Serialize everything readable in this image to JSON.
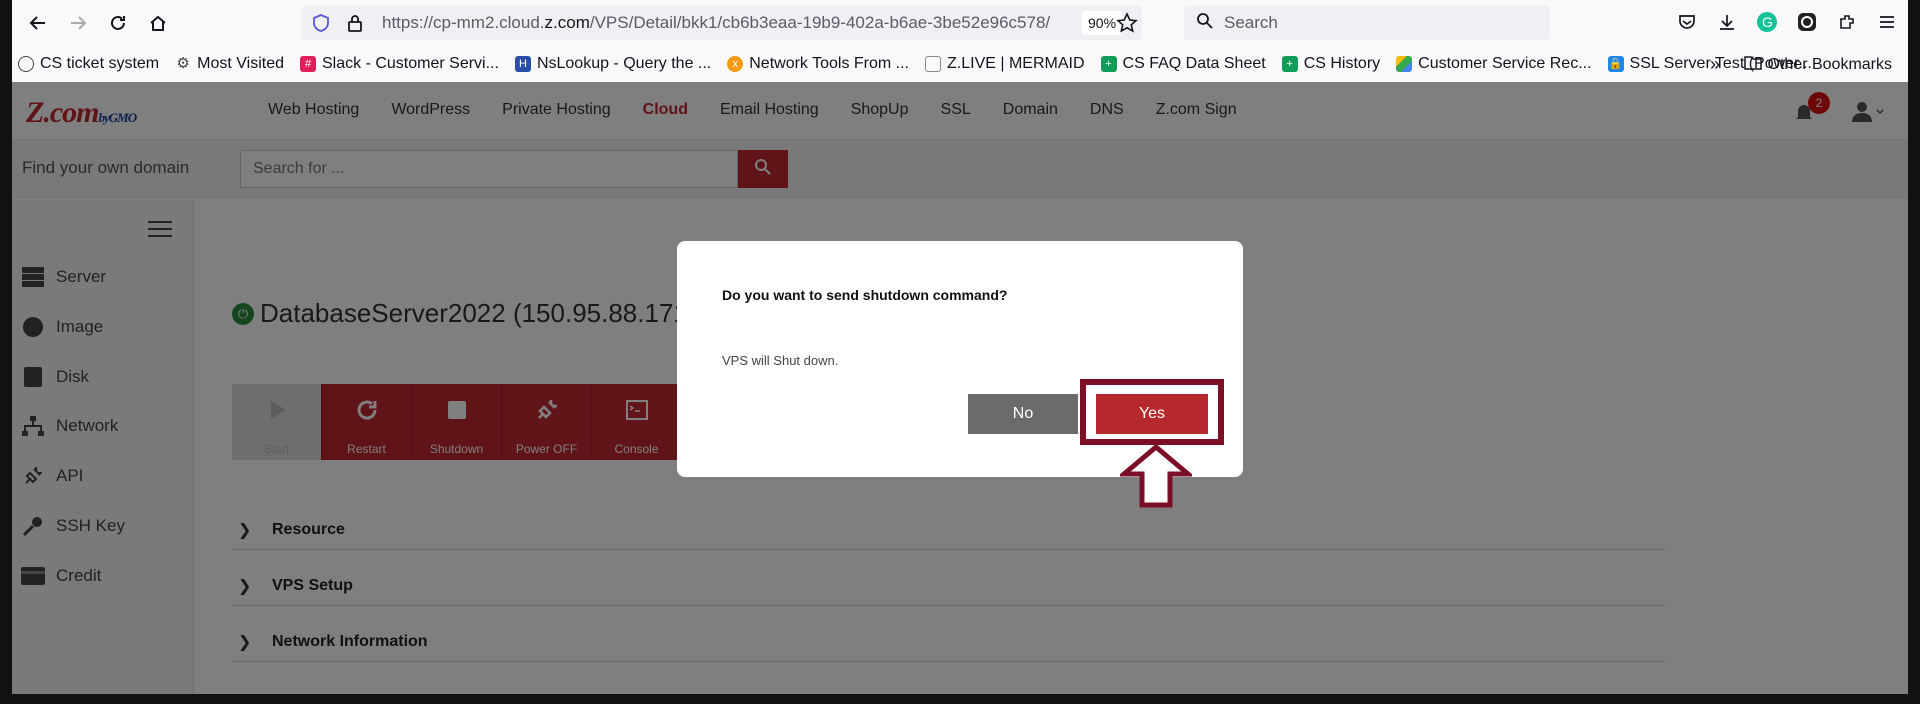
{
  "browser": {
    "url_prefix": "https://cp-mm2.cloud.",
    "url_domain": "z.com",
    "url_path": "/VPS/Detail/bkk1/cb6b3eaa-19b9-402a-b6ae-3be52e96c578/",
    "zoom": "90%",
    "search_placeholder": "Search"
  },
  "bookmarks": [
    {
      "label": "CS ticket system",
      "color": "#444"
    },
    {
      "label": "Most Visited",
      "color": "#555"
    },
    {
      "label": "Slack - Customer Servi...",
      "color": "#4a154b"
    },
    {
      "label": "NsLookup - Query the ...",
      "color": "#2b4fa8"
    },
    {
      "label": "Network Tools From ...",
      "color": "#f39c12"
    },
    {
      "label": "Z.LIVE | MERMAID",
      "color": "#888"
    },
    {
      "label": "CS FAQ Data Sheet",
      "color": "#0f9d58"
    },
    {
      "label": "CS History",
      "color": "#0f9d58"
    },
    {
      "label": "Customer Service Rec...",
      "color": "#1a73e8"
    },
    {
      "label": "SSL Server Test (Power...",
      "color": "#1e88e5"
    }
  ],
  "other_bookmarks": "Other Bookmarks",
  "site": {
    "logo": "Z.com",
    "logo_sub": "byGMO",
    "nav": [
      "Web Hosting",
      "WordPress",
      "Private Hosting",
      "Cloud",
      "Email Hosting",
      "ShopUp",
      "SSL",
      "Domain",
      "DNS",
      "Z.com Sign"
    ],
    "active_nav": "Cloud",
    "notification_count": "2",
    "find_domain_label": "Find your own domain",
    "domain_search_placeholder": "Search for ..."
  },
  "sidebar": {
    "items": [
      "Server",
      "Image",
      "Disk",
      "Network",
      "API",
      "SSH Key",
      "Credit"
    ]
  },
  "server": {
    "title": "DatabaseServer2022 (150.95.88.171)",
    "actions": [
      "Start",
      "Restart",
      "Shutdown",
      "Power OFF",
      "Console"
    ]
  },
  "sections": [
    "Resource",
    "VPS Setup",
    "Network Information"
  ],
  "modal": {
    "title": "Do you want to send shutdown command?",
    "body": "VPS will Shut down.",
    "no_label": "No",
    "yes_label": "Yes"
  }
}
